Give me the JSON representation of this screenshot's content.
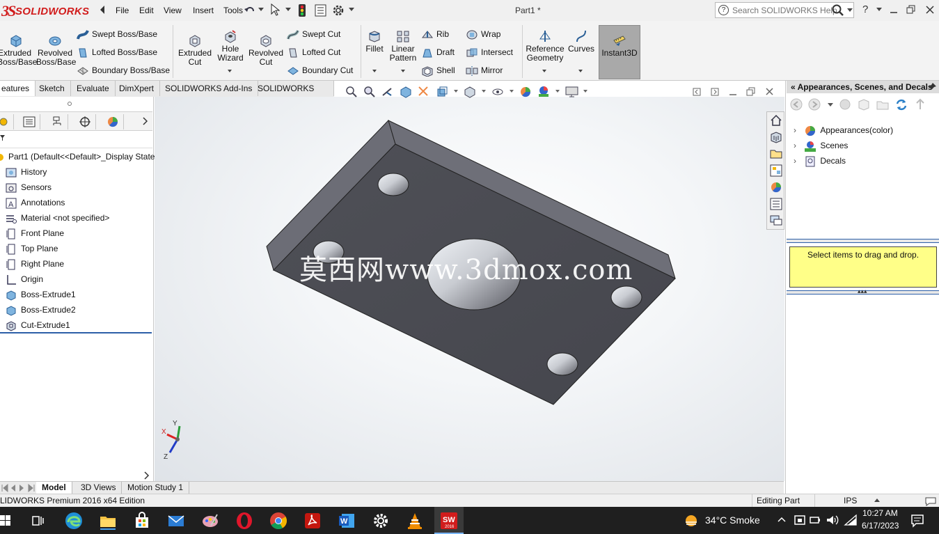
{
  "titlebar": {
    "logo_text": "SOLIDWORKS",
    "menus": [
      "File",
      "Edit",
      "View",
      "Insert",
      "Tools"
    ],
    "doc_title": "Part1 *",
    "search_placeholder": "Search SOLIDWORKS Help",
    "help_label": "?"
  },
  "ribbon": {
    "extruded_boss": "Extruded Boss/Base",
    "revolved_boss": "Revolved Boss/Base",
    "swept_boss": "Swept Boss/Base",
    "lofted_boss": "Lofted Boss/Base",
    "boundary_boss": "Boundary Boss/Base",
    "extruded_cut": "Extruded Cut",
    "hole_wizard": "Hole Wizard",
    "revolved_cut": "Revolved Cut",
    "swept_cut": "Swept Cut",
    "lofted_cut": "Lofted Cut",
    "boundary_cut": "Boundary Cut",
    "fillet": "Fillet",
    "linear_pattern": "Linear Pattern",
    "rib": "Rib",
    "draft": "Draft",
    "shell": "Shell",
    "wrap": "Wrap",
    "intersect": "Intersect",
    "mirror": "Mirror",
    "reference_geometry": "Reference Geometry",
    "curves": "Curves",
    "instant3d": "Instant3D"
  },
  "tabs": [
    "eatures",
    "Sketch",
    "Evaluate",
    "DimXpert",
    "SOLIDWORKS Add-Ins",
    "SOLIDWORKS MBD"
  ],
  "tree": {
    "root": "Part1  (Default<<Default>_Display State",
    "items": [
      "History",
      "Sensors",
      "Annotations",
      "Material <not specified>",
      "Front Plane",
      "Top Plane",
      "Right Plane",
      "Origin",
      "Boss-Extrude1",
      "Boss-Extrude2",
      "Cut-Extrude1"
    ]
  },
  "bottom_tabs": [
    "Model",
    "3D Views",
    "Motion Study 1"
  ],
  "status": {
    "edition": "LIDWORKS Premium 2016 x64 Edition",
    "mode": "Editing Part",
    "units": "IPS"
  },
  "right_pane": {
    "title": "Appearances, Scenes, and Decals",
    "items": [
      "Appearances(color)",
      "Scenes",
      "Decals"
    ],
    "hint": "Select items to drag and drop."
  },
  "triad": {
    "x": "X",
    "y": "Y",
    "z": "Z"
  },
  "watermark": "莫西网www.3dmox.com",
  "taskbar": {
    "weather": "34°C  Smoke",
    "time": "10:27 AM",
    "date": "6/17/2023"
  },
  "colors": {
    "brand_red": "#d11c1c",
    "part_top": "#4a4b52",
    "part_side": "#6a6b74",
    "hint_yellow": "#ffff88",
    "selection_blue": "#2c5ea7"
  }
}
